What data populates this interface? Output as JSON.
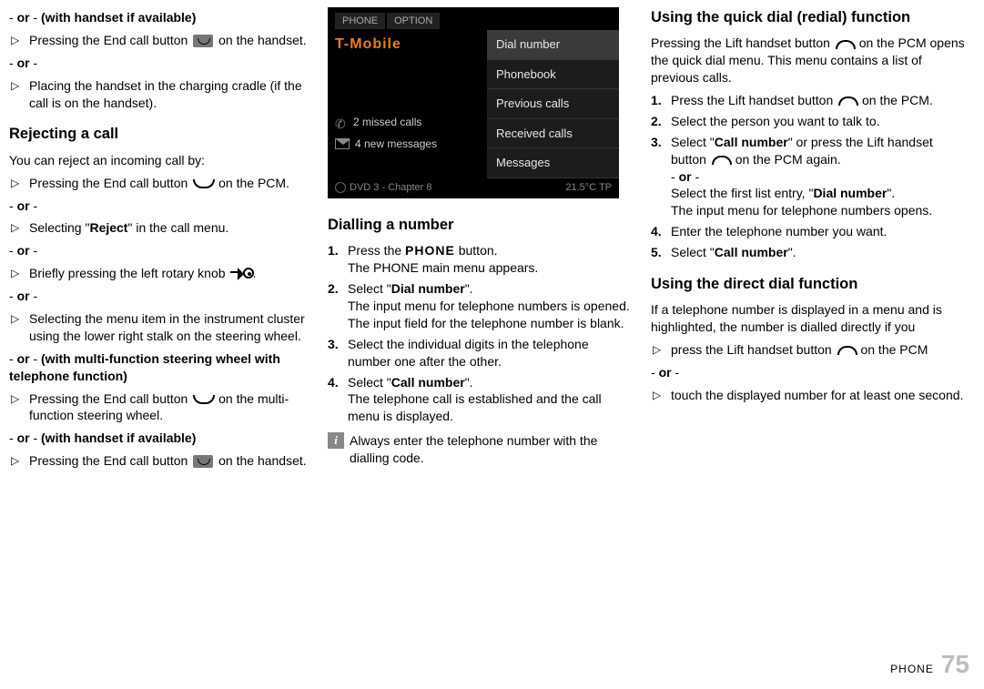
{
  "col1": {
    "or_handset": "- or - (with handset if available)",
    "end_hs_a": "Pressing the End call button ",
    "end_hs_b": " on the hand­set.",
    "or": "- or -",
    "cradle": "Placing the handset in the charging cradle (if the call is on the handset).",
    "rejecting_h": "Rejecting a call",
    "reject_intro": "You can reject an incoming call by:",
    "reject1_a": "Pressing the End call button ",
    "reject1_b": " on the PCM.",
    "reject2_a": "Selecting \"",
    "reject2_b": "Reject",
    "reject2_c": "\" in the call menu.",
    "reject3_a": "Briefly pressing the left rotary knob ",
    "reject3_b": ".",
    "reject4": "Selecting the menu item in the instrument clus­ter using the lower right stalk on the steering wheel.",
    "or_mf": "- or - (with multi-function steering wheel with telephone function)",
    "reject5_a": "Pressing the End call button ",
    "reject5_b": " on the multi-function steering wheel.",
    "reject6_a": "Pressing the End call button ",
    "reject6_b": " on the hand­set."
  },
  "screenshot": {
    "tab_phone": "PHONE",
    "tab_option": "OPTION",
    "carrier": "T-Mobile",
    "missed": "2 missed calls",
    "newmsg": "4 new messages",
    "menu": [
      "Dial number",
      "Phonebook",
      "Previous calls",
      "Received calls",
      "Messages"
    ],
    "bottom_left": "DVD 3 - Chapter 8",
    "bottom_right": "21.5°C  TP"
  },
  "col2": {
    "dial_h": "Dialling a number",
    "s1a": "Press the ",
    "s1btn": "PHONE",
    "s1b": " button.",
    "s1c": "The PHONE main menu appears.",
    "s2a": "Select \"",
    "s2b": "Dial number",
    "s2c": "\".",
    "s2d": "The input menu for telephone numbers is opened. The input field for the telephone number is blank.",
    "s3": "Select the individual digits in the telephone number one after the other.",
    "s4a": "Select \"",
    "s4b": "Call number",
    "s4c": "\".",
    "s4d": "The telephone call is established and the call menu is displayed.",
    "info": "Always enter the telephone number with the dialling code."
  },
  "col3": {
    "quick_h": "Using the quick dial (redial) function",
    "q_intro_a": "Pressing the Lift handset button ",
    "q_intro_b": " on the PCM opens the quick dial menu. This menu contains a list of previous calls.",
    "q1a": "Press the Lift handset button ",
    "q1b": " on the PCM.",
    "q2": "Select the person you want to talk to.",
    "q3a": "Select \"",
    "q3b": "Call number",
    "q3c": "\" or press the Lift handset button ",
    "q3d": " on the PCM again.",
    "q3or": "- or -",
    "q3e": "Select the first list entry, \"",
    "q3f": "Dial number",
    "q3g": "\".",
    "q3h": "The input menu for telephone numbers opens.",
    "q4": "Enter the telephone number you want.",
    "q5a": "Select \"",
    "q5b": "Call number",
    "q5c": "\".",
    "direct_h": "Using the direct dial function",
    "d_intro": "If a telephone number is displayed in a menu and is highlighted, the number is dialled directly if you",
    "d1a": "press the Lift handset button ",
    "d1b": " on the PCM",
    "d_or": "- or -",
    "d2": "touch the displayed number for at least one second."
  },
  "footer": {
    "label": "PHONE",
    "page": "75"
  }
}
